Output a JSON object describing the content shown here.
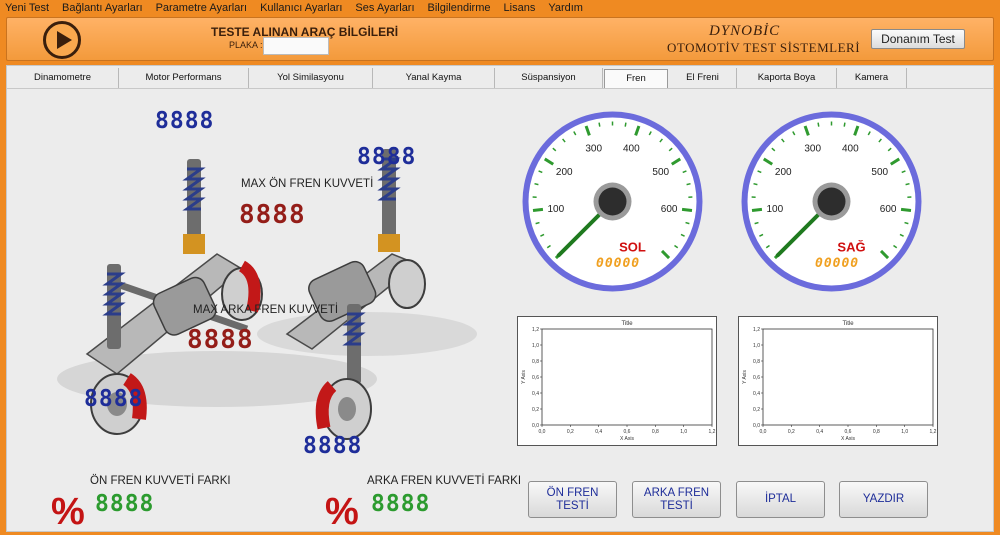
{
  "menu": [
    "Yeni Test",
    "Bağlantı Ayarları",
    "Parametre Ayarları",
    "Kullanıcı Ayarları",
    "Ses Ayarları",
    "Bilgilendirme",
    "Lisans",
    "Yardım"
  ],
  "header": {
    "title": "TESTE ALINAN ARAÇ BİLGİLERİ",
    "plate_label": "PLAKA :",
    "plate_value": "",
    "brand_logo": "DYNOBİC",
    "brand_sub": "OTOMOTİV TEST SİSTEMLERİ",
    "hardware_test_label": "Donanım Test"
  },
  "tabs": [
    {
      "label": "Dinamometre"
    },
    {
      "label": "Motor Performans"
    },
    {
      "label": "Yol Similasyonu"
    },
    {
      "label": "Yanal Kayma"
    },
    {
      "label": "Süspansiyon"
    },
    {
      "label": "Fren",
      "active": true
    },
    {
      "label": "El Freni"
    },
    {
      "label": "Kaporta Boya"
    },
    {
      "label": "Kamera"
    }
  ],
  "readouts": {
    "front_left": "8888",
    "front_right": "8888",
    "rear_left": "8888",
    "rear_right": "8888",
    "max_front": "8888",
    "max_rear": "8888",
    "front_diff": "8888",
    "rear_diff": "8888"
  },
  "labels": {
    "max_front_label": "MAX ÖN FREN KUVVETİ",
    "max_rear_label": "MAX ARKA FREN KUVVETİ",
    "front_diff_label": "ÖN FREN KUVVETİ FARKI",
    "rear_diff_label": "ARKA FREN KUVVETİ FARKI",
    "percent_symbol": "%"
  },
  "gauges": [
    {
      "id": "left",
      "label": "SOL",
      "readout": "00000",
      "ticks": [
        "100",
        "200",
        "300",
        "400",
        "500",
        "600"
      ],
      "value": 0
    },
    {
      "id": "right",
      "label": "SAĞ",
      "readout": "00000",
      "ticks": [
        "100",
        "200",
        "300",
        "400",
        "500",
        "600"
      ],
      "value": 0
    }
  ],
  "graphs": [
    {
      "title": "Title",
      "xlabel": "X Axis",
      "ylabel": "Y Axis",
      "x_ticks": [
        "0,0",
        "0,2",
        "0,4",
        "0,6",
        "0,8",
        "1,0",
        "1,2"
      ],
      "y_ticks": [
        "0,0",
        "0,2",
        "0,4",
        "0,6",
        "0,8",
        "1,0",
        "1,2"
      ],
      "xlim": [
        0,
        1.2
      ],
      "ylim": [
        0,
        1.2
      ]
    },
    {
      "title": "Title",
      "xlabel": "X Axis",
      "ylabel": "Y Axis",
      "x_ticks": [
        "0,0",
        "0,2",
        "0,4",
        "0,6",
        "0,8",
        "1,0",
        "1,2"
      ],
      "y_ticks": [
        "0,0",
        "0,2",
        "0,4",
        "0,6",
        "0,8",
        "1,0",
        "1,2"
      ],
      "xlim": [
        0,
        1.2
      ],
      "ylim": [
        0,
        1.2
      ]
    }
  ],
  "buttons": {
    "front_test": "ÖN FREN TESTİ",
    "rear_test": "ARKA FREN TESTİ",
    "cancel": "İPTAL",
    "print": "YAZDIR"
  },
  "colors": {
    "accent": "#ef8a22",
    "lcd_blue": "#1e2d99",
    "lcd_red": "#941d18",
    "lcd_green": "#2c9b2f",
    "gauge_rim": "#6b6bdc",
    "gauge_tick": "#2f9a2f",
    "needle": "#1f7a1f",
    "gauge_label": "#d01010"
  }
}
